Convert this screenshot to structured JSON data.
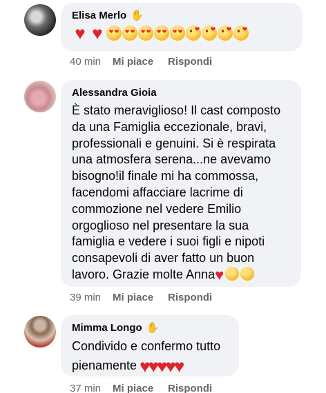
{
  "comments": [
    {
      "author": "Elisa Merlo",
      "badge_icon": "waving-hand-icon",
      "emoji": [
        "heart",
        "heart",
        "heart-eyes-face",
        "heart-eyes-face",
        "smiling-face-with-hearts",
        "smiling-face-with-hearts",
        "smiling-face-with-hearts",
        "face-blowing-kiss",
        "face-blowing-kiss",
        "face-blowing-kiss",
        "face-blowing-kiss"
      ],
      "time": "40 min",
      "like": "Mi piace",
      "reply": "Rispondi"
    },
    {
      "author": "Alessandra Gioia",
      "text": "È stato meraviglioso! Il cast composto da una Famiglia eccezionale,  bravi, professionali e genuini. Si è respirata una atmosfera serena...ne avevamo bisogno!il finale mi ha commossa, facendomi affacciare lacrime di commozione nel vedere Emilio orgoglioso nel presentare la sua famiglia e vedere i suoi figli e nipoti consapevoli di aver fatto un buon lavoro.  Grazie molte Anna",
      "trailing_emoji": [
        "heart",
        "face-blowing-kiss",
        "face-blowing-kiss"
      ],
      "time": "39 min",
      "like": "Mi piace",
      "reply": "Rispondi"
    },
    {
      "author": "Mimma Longo",
      "badge_icon": "waving-hand-icon",
      "text": "Condivido e confermo tutto pienamente",
      "trailing_emoji": [
        "heart",
        "heart",
        "heart",
        "heart",
        "heart"
      ],
      "time": "37 min",
      "like": "Mi piace",
      "reply": "Rispondi"
    }
  ],
  "colors": {
    "bubble": "#f0f2f5",
    "meta_text": "#65676b",
    "heart": "#e0242c"
  }
}
